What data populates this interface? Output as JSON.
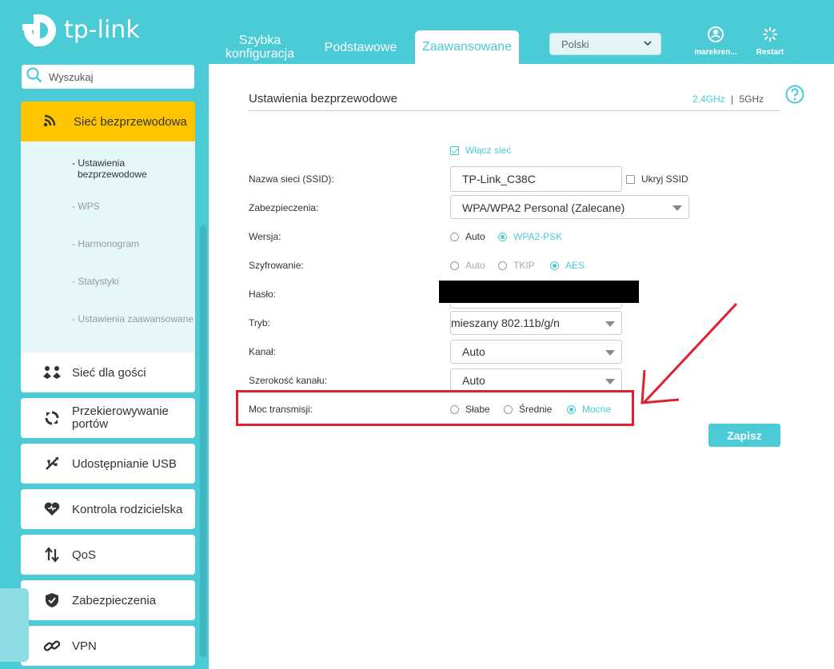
{
  "brand": {
    "logo_text": "tp-link"
  },
  "header": {
    "tabs": [
      "Szybka konfiguracja",
      "Podstawowe",
      "Zaawansowane"
    ],
    "tab_quick_line1": "Szybka",
    "tab_quick_line2": "konfiguracja",
    "language": "Polski",
    "user_label": "marekren...",
    "restart_label": "Restart"
  },
  "sidebar": {
    "search_placeholder": "Wyszukaj",
    "active_section": "Sieć bezprzewodowa",
    "sub_items": [
      {
        "line1": "- Ustawienia",
        "line2": "bezprzewodowe"
      },
      {
        "line1": "- WPS"
      },
      {
        "line1": "- Harmonogram"
      },
      {
        "line1": "- Statystyki"
      },
      {
        "line1": "- Ustawienia zaawansowane"
      }
    ],
    "items": [
      {
        "label": "Sieć dla gości",
        "icon": "guest-icon"
      },
      {
        "label_line1": "Przekierowywanie",
        "label_line2": "portów",
        "icon": "forwarding-icon"
      },
      {
        "label": "Udostępnianie USB",
        "icon": "usb-icon"
      },
      {
        "label": "Kontrola rodzicielska",
        "icon": "heart-icon"
      },
      {
        "label": "QoS",
        "icon": "qos-arrows-icon"
      },
      {
        "label": "Zabezpieczenia",
        "icon": "shield-icon"
      },
      {
        "label": "VPN",
        "icon": "link-icon"
      }
    ]
  },
  "panel": {
    "title": "Ustawienia bezprzewodowe",
    "band_24": "2,4GHz",
    "band_sep": "|",
    "band_5": "5GHz",
    "enable_label": "Włącz sieć",
    "ssid_label": "Nazwa sieci (SSID):",
    "ssid_value": "TP-Link_C38C",
    "hide_ssid_label": "Ukryj SSID",
    "security_label": "Zabezpieczenia:",
    "security_value": "WPA/WPA2 Personal (Zalecane)",
    "version_label": "Wersja:",
    "version_options": [
      "Auto",
      "WPA2-PSK"
    ],
    "encryption_label": "Szyfrowanie:",
    "encryption_options": [
      "Auto",
      "TKIP",
      "AES"
    ],
    "password_label": "Hasło:",
    "mode_label": "Tryb:",
    "mode_value": "mieszany 802.11b/g/n",
    "channel_label": "Kanał:",
    "channel_value": "Auto",
    "width_label": "Szerokość kanału:",
    "width_value": "Auto",
    "power_label": "Moc transmisji:",
    "power_options": [
      "Słabe",
      "Średnie",
      "Mocne"
    ],
    "save_label": "Zapisz"
  },
  "colors": {
    "accent": "#4acbd6",
    "active_nav": "#ffc400",
    "annotation": "#e0202a"
  }
}
